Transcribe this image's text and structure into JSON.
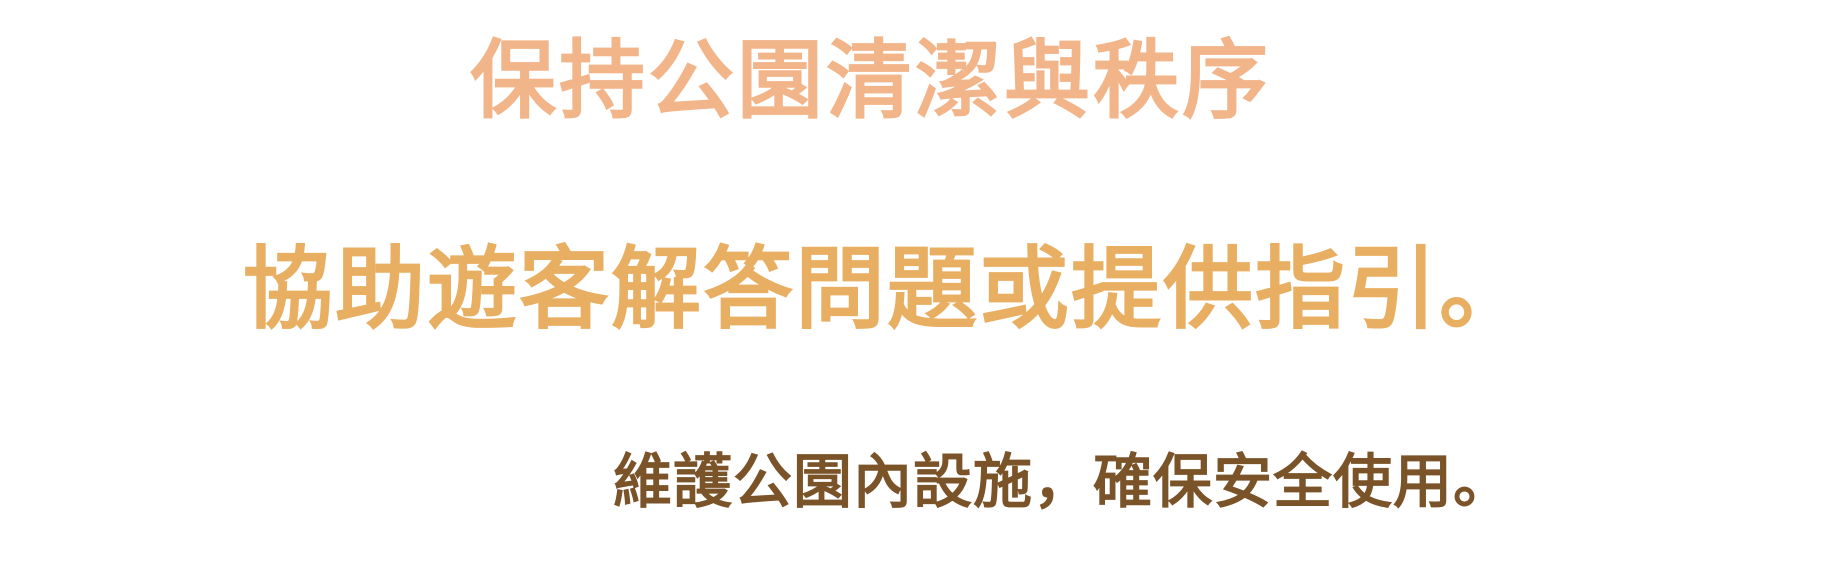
{
  "lines": [
    {
      "text": "保持公園清潔與秩序",
      "color": "#F2B489"
    },
    {
      "text": "協助遊客解答問題或提供指引。",
      "color": "#E8AE62"
    },
    {
      "text": "維護公園內設施，確保安全使用。",
      "color": "#7A5328"
    }
  ]
}
